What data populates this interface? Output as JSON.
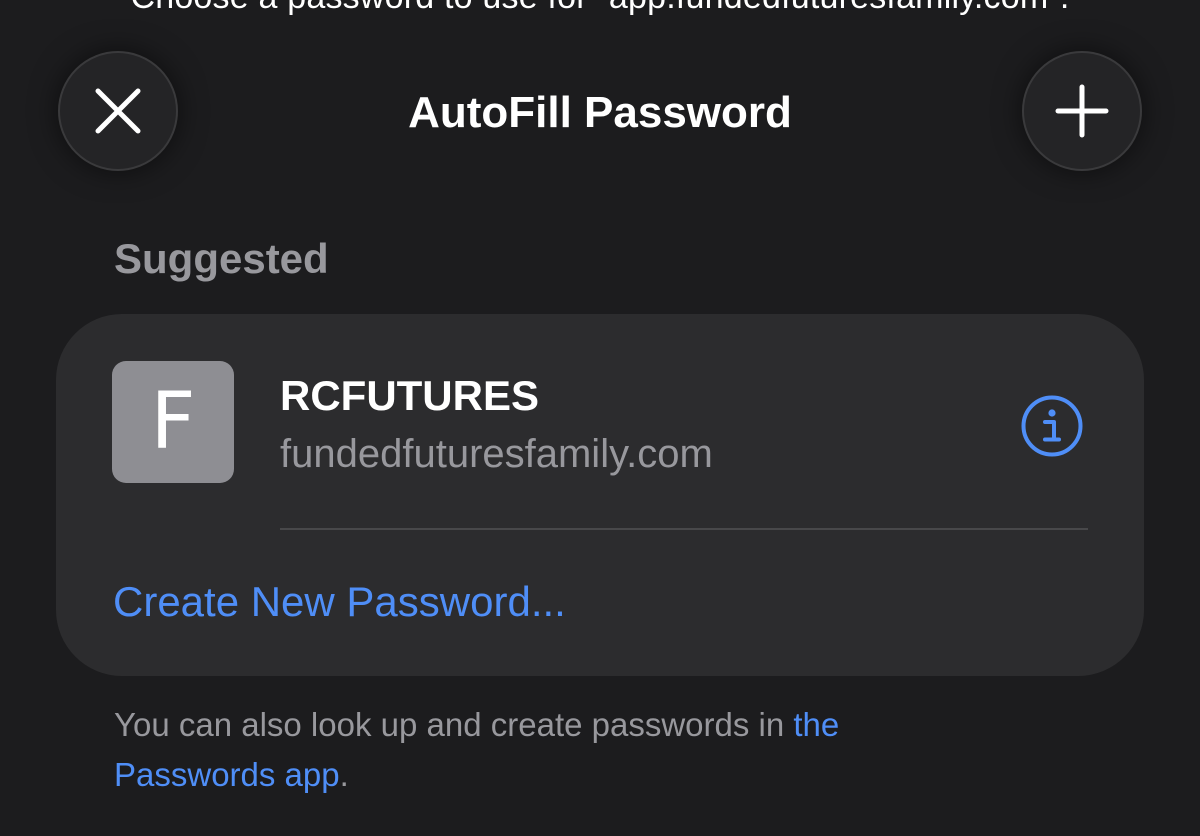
{
  "top_prompt": "Choose a password to use for “app.fundedfuturesfamily.com”.",
  "header": {
    "title": "AutoFill Password",
    "close_icon": "close-icon",
    "add_icon": "plus-icon"
  },
  "suggested": {
    "label": "Suggested",
    "entry": {
      "avatar_letter": "F",
      "title": "RCFUTURES",
      "domain": "fundedfuturesfamily.com",
      "info_icon": "info-icon"
    },
    "create_label": "Create New Password..."
  },
  "footer": {
    "text": "You can also look up and create passwords in ",
    "link": "the Passwords app",
    "end": "."
  },
  "colors": {
    "background": "#1c1c1e",
    "card": "#2c2c2e",
    "accent": "#4f8ef7",
    "secondary_text": "#98989d"
  }
}
